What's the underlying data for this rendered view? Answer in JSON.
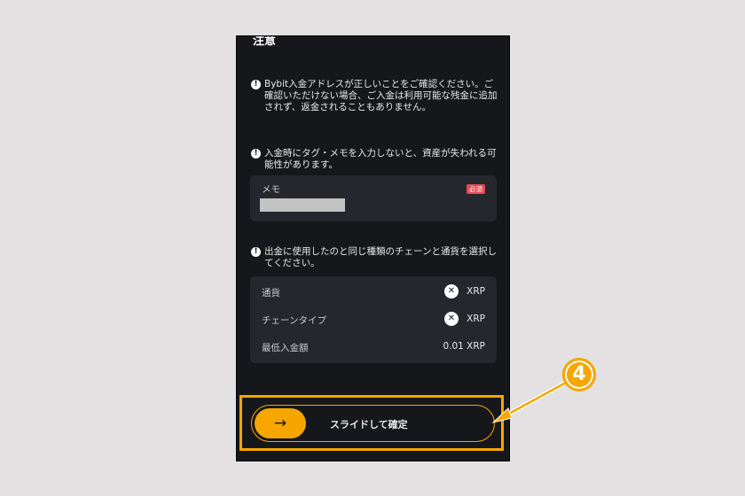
{
  "header": {
    "title_fragment": "注意"
  },
  "notices": [
    {
      "text": "Bybit入金アドレスが正しいことをご確認ください。ご確認いただけない場合、ご入金は利用可能な残金に追加されず、返金されることもありません。"
    },
    {
      "text": "入金時にタグ・メモを入力しないと、資産が失われる可能性があります。"
    },
    {
      "text": "出金に使用したのと同じ種類のチェーンと通貨を選択してください。"
    }
  ],
  "memo": {
    "label": "メモ",
    "required_badge": "必須"
  },
  "details": {
    "currency_label": "通貨",
    "currency_value": "XRP",
    "chain_label": "チェーンタイプ",
    "chain_value": "XRP",
    "min_deposit_label": "最低入金額",
    "min_deposit_value": "0.01 XRP"
  },
  "slider": {
    "label": "スライドして確定",
    "handle_icon": "→"
  },
  "annotation": {
    "marker": "4"
  },
  "colors": {
    "accent": "#f7a600",
    "panel": "#16171a",
    "card": "#26272c",
    "badge": "#e14b54"
  }
}
